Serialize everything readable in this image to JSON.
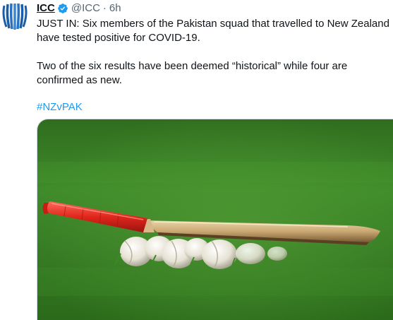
{
  "tweet": {
    "display_name": "ICC",
    "handle": "@ICC",
    "separator": "·",
    "time": "6h",
    "paragraph_1": "JUST IN: Six members of the Pakistan squad that travelled to New Zealand have tested positive for COVID-19.",
    "paragraph_2": "Two of the six results have been deemed “historical” while four are confirmed as new.",
    "hashtag": "#NZvPAK"
  },
  "icons": {
    "avatar": "icc-logo-avatar",
    "verified": "verified-badge-icon"
  },
  "colors": {
    "accent": "#1d9bf0",
    "text": "#0f1419",
    "muted": "#536471",
    "logo_blue": "#1b5ea7"
  }
}
